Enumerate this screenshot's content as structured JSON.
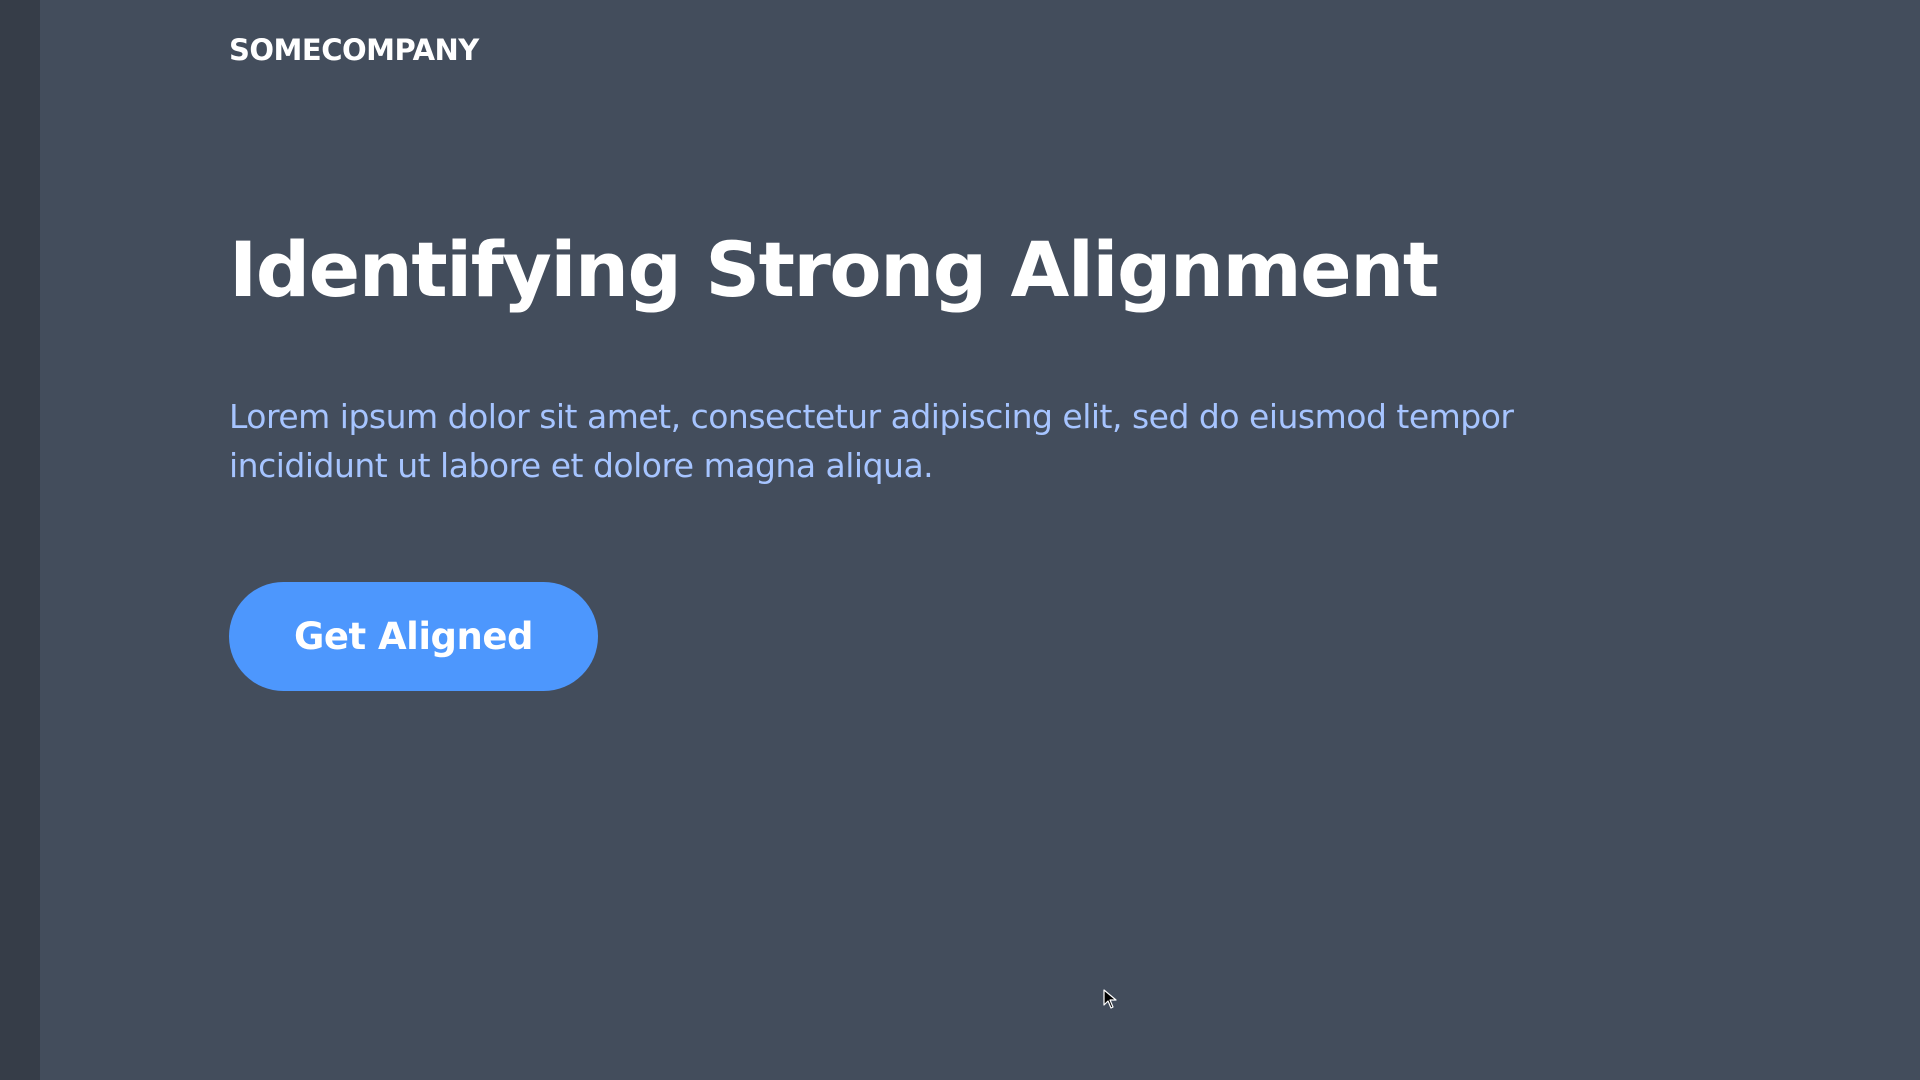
{
  "header": {
    "brand": "SOMECOMPANY"
  },
  "hero": {
    "title": "Identifying Strong Alignment",
    "description": "Lorem ipsum dolor sit amet, consectetur adipiscing elit, sed do eiusmod tempor incididunt ut labore et dolore magna aliqua.",
    "cta_label": "Get Aligned"
  },
  "colors": {
    "background": "#434d5c",
    "left_rail": "#363d48",
    "text_primary": "#ffffff",
    "text_secondary": "#a6c4ff",
    "accent": "#4d97fd"
  },
  "icons": {
    "cursor": "mouse-pointer-icon"
  }
}
